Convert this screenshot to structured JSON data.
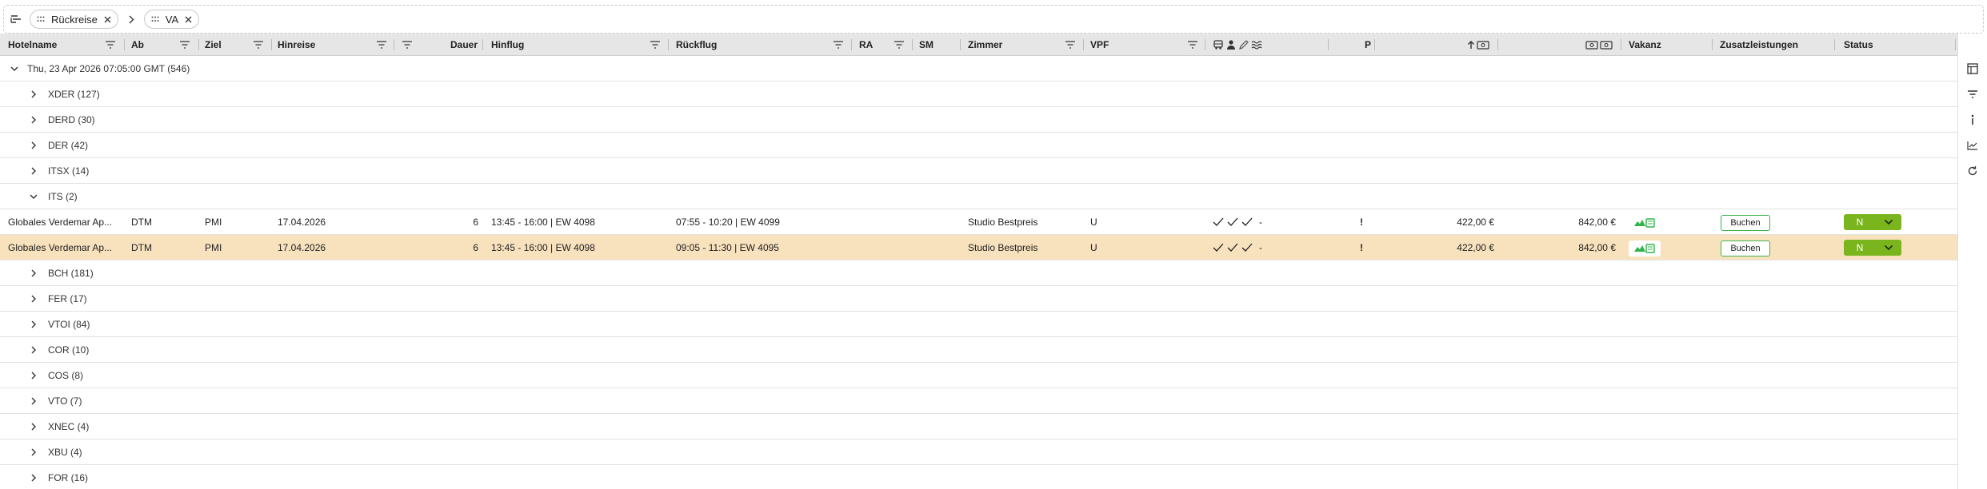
{
  "group_bar": {
    "chips": [
      {
        "label": "Rückreise"
      },
      {
        "label": "VA"
      }
    ]
  },
  "columns": {
    "hotelname": "Hotelname",
    "ab": "Ab",
    "ziel": "Ziel",
    "hinreise": "Hinreise",
    "dauer": "Dauer",
    "hinflug": "Hinflug",
    "rueckflug": "Rückflug",
    "ra": "RA",
    "sm": "SM",
    "zimmer": "Zimmer",
    "vpf": "VPF",
    "p": "P",
    "vakanz": "Vakanz",
    "zusatzleistungen": "Zusatzleistungen",
    "status": "Status"
  },
  "date_group": {
    "label": "Thu, 23 Apr 2026 07:05:00 GMT (546)"
  },
  "groups_before": [
    {
      "label": "XDER (127)"
    },
    {
      "label": "DERD (30)"
    },
    {
      "label": "DER (42)"
    },
    {
      "label": "ITSX (14)"
    }
  ],
  "open_group": {
    "label": "ITS (2)"
  },
  "rows": [
    {
      "hotelname": "Globales Verdemar Ap...",
      "ab": "DTM",
      "ziel": "PMI",
      "hinreise": "17.04.2026",
      "dauer": "6",
      "hinflug": "13:45 - 16:00 | EW 4098",
      "rueckflug": "07:55 - 10:20 | EW 4099",
      "zimmer": "Studio Bestpreis",
      "vpf": "U",
      "dash": "-",
      "p": "!",
      "price1": "422,00 €",
      "price2": "842,00 €",
      "buchen": "Buchen",
      "status": "N",
      "selected": false
    },
    {
      "hotelname": "Globales Verdemar Ap...",
      "ab": "DTM",
      "ziel": "PMI",
      "hinreise": "17.04.2026",
      "dauer": "6",
      "hinflug": "13:45 - 16:00 | EW 4098",
      "rueckflug": "09:05 - 11:30 | EW 4095",
      "zimmer": "Studio Bestpreis",
      "vpf": "U",
      "dash": "-",
      "p": "!",
      "price1": "422,00 €",
      "price2": "842,00 €",
      "buchen": "Buchen",
      "status": "N",
      "selected": true
    }
  ],
  "groups_after": [
    {
      "label": "BCH (181)"
    },
    {
      "label": "FER (17)"
    },
    {
      "label": "VTOI (84)"
    },
    {
      "label": "COR (10)"
    },
    {
      "label": "COS (8)"
    },
    {
      "label": "VTO (7)"
    },
    {
      "label": "XNEC (4)"
    },
    {
      "label": "XBU (4)"
    },
    {
      "label": "FOR (16)"
    }
  ],
  "colors": {
    "header_bg": "#e6e6e6",
    "selected_row": "#f8e1bd",
    "status_green": "#7ab51d",
    "buchen_border": "#3bb54a",
    "vacancy_green": "#2fb34a"
  },
  "sidebar_icons": [
    "columns-icon",
    "filter-icon",
    "info-icon",
    "chart-icon",
    "refresh-icon"
  ]
}
